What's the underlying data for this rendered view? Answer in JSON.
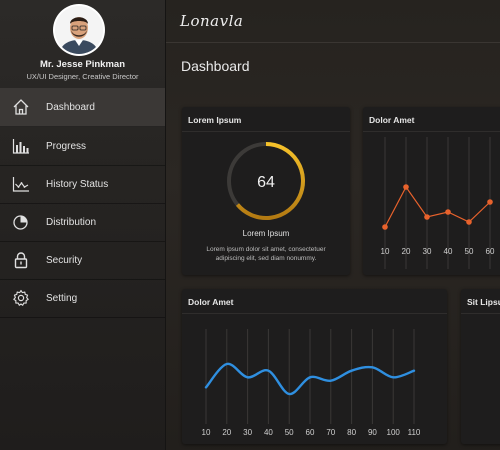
{
  "profile": {
    "name": "Mr. Jesse Pinkman",
    "role": "UX/UI Designer, Creative Director"
  },
  "sidebar": {
    "items": [
      {
        "label": "Dashboard",
        "icon": "home-icon",
        "active": true
      },
      {
        "label": "Progress",
        "icon": "bar-chart-icon"
      },
      {
        "label": "History Status",
        "icon": "line-chart-icon"
      },
      {
        "label": "Distribution",
        "icon": "pie-chart-icon"
      },
      {
        "label": "Security",
        "icon": "lock-icon"
      },
      {
        "label": "Setting",
        "icon": "gear-icon"
      }
    ]
  },
  "header": {
    "brand": "Lonavla",
    "title": "Dashboard"
  },
  "cards": {
    "lorem": {
      "title": "Lorem Ipsum",
      "value": "64",
      "label": "Lorem Ipsum",
      "description": "Lorem ipsum dolor sit amet, consectetuer adipiscing elit, sed diam nonummy."
    },
    "dolor_top": {
      "title": "Dolor Amet"
    },
    "dolor_bottom": {
      "title": "Dolor Amet"
    },
    "sit": {
      "title": "Sit Lipsu"
    }
  },
  "colors": {
    "accent_orange": "#e8622c",
    "gauge_yellow": "#f2b51f",
    "line_blue": "#2f8fe0"
  },
  "chart_data": [
    {
      "type": "gauge",
      "value": 64,
      "max": 100
    },
    {
      "type": "line",
      "x": [
        10,
        20,
        30,
        40,
        50,
        60
      ],
      "values": [
        14,
        18,
        15,
        15.5,
        14.5,
        16.5
      ],
      "ylim": [
        12,
        20
      ]
    },
    {
      "type": "line",
      "x": [
        10,
        20,
        30,
        40,
        50,
        60,
        70,
        80,
        90,
        100,
        110
      ],
      "values": [
        21,
        28,
        24,
        26,
        19,
        24,
        23,
        26,
        27,
        24,
        26
      ],
      "ylim": [
        10,
        40
      ]
    }
  ]
}
